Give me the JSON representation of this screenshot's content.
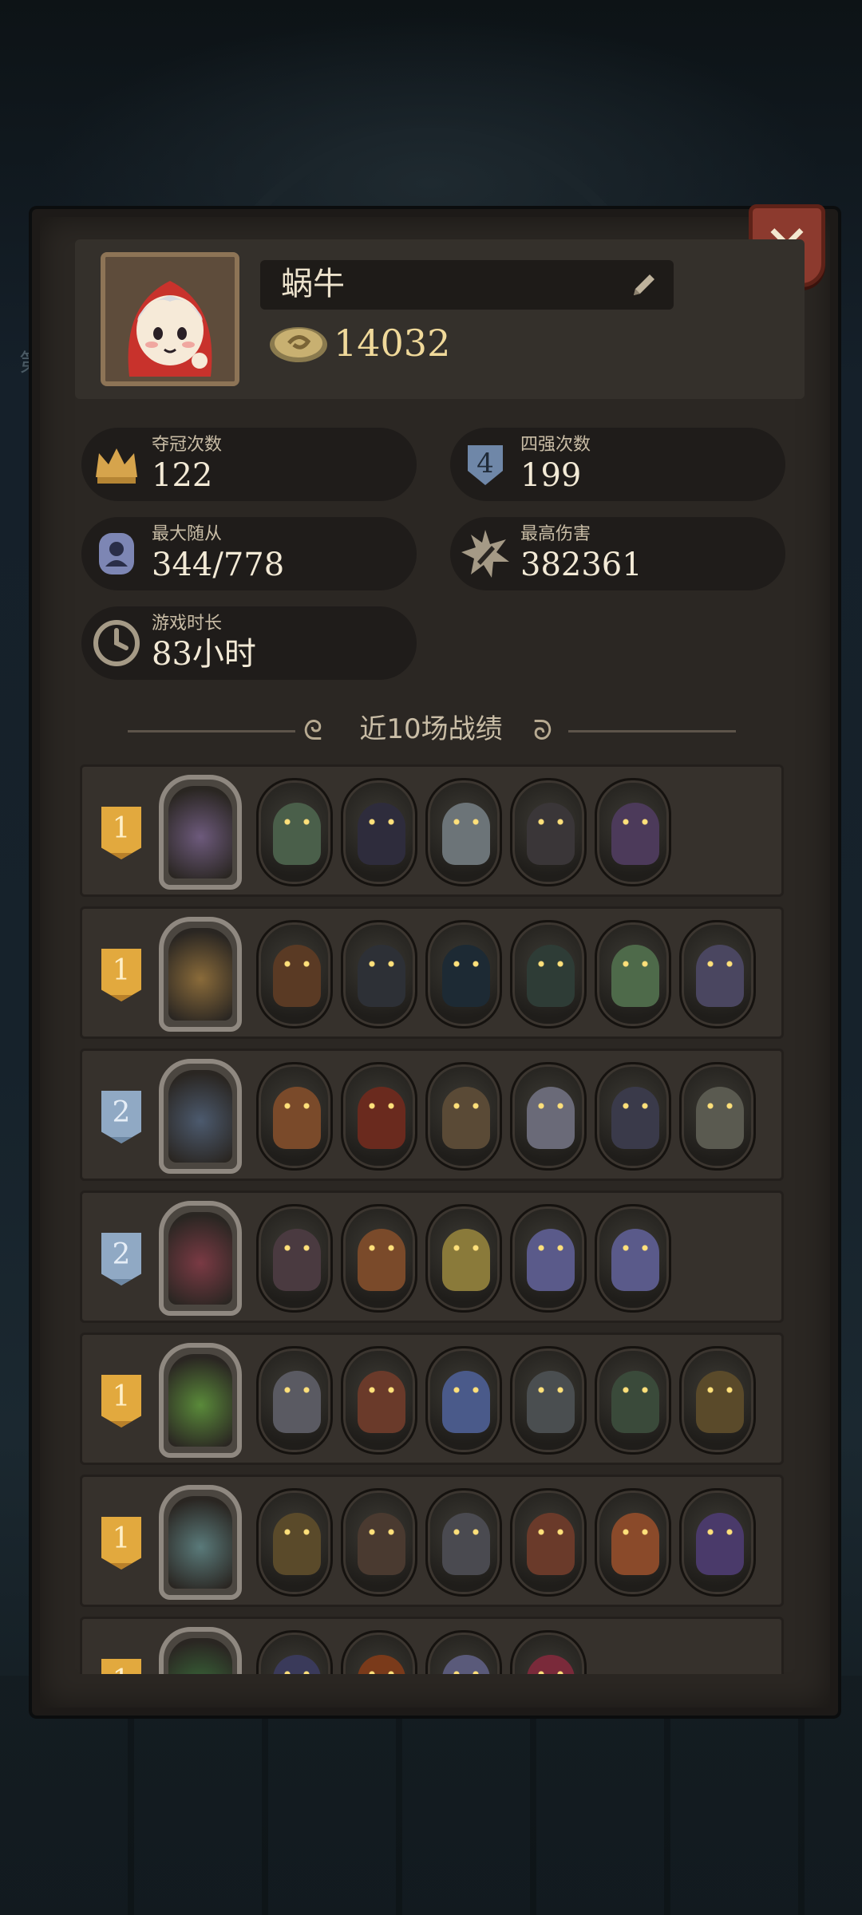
{
  "background": {
    "side_text": "第"
  },
  "profile": {
    "name": "蜗牛",
    "coins": "14032"
  },
  "stats": [
    {
      "label": "夺冠次数",
      "value": "122",
      "icon": "crown-icon"
    },
    {
      "label": "四强次数",
      "value": "199",
      "icon": "shield-four-icon"
    },
    {
      "label": "最大随从",
      "value": "344/778",
      "icon": "follower-icon"
    },
    {
      "label": "最高伤害",
      "value": "382361",
      "icon": "damage-burst-icon"
    },
    {
      "label": "游戏时长",
      "value": "83小时",
      "icon": "clock-icon"
    }
  ],
  "section": {
    "title": "近10场战绩"
  },
  "matches": [
    {
      "rank": "1",
      "tier": "gold",
      "hero": "#6d5a7c",
      "units": [
        "#4a5f4a",
        "#2e2c3c",
        "#6c7478",
        "#3a3638",
        "#4c3a5a"
      ]
    },
    {
      "rank": "1",
      "tier": "gold",
      "hero": "#8a6b3a",
      "units": [
        "#5a3a24",
        "#2d3036",
        "#1d2a34",
        "#2e3c36",
        "#4e6a4a",
        "#4a4660"
      ]
    },
    {
      "rank": "2",
      "tier": "silver",
      "hero": "#4c5a6e",
      "units": [
        "#7a4a2a",
        "#6a2a1e",
        "#5a4a36",
        "#6a6a78",
        "#3a3a4a",
        "#5a5a50"
      ]
    },
    {
      "rank": "2",
      "tier": "silver",
      "hero": "#7a3a44",
      "units": [
        "#4a3a40",
        "#7a4a2a",
        "#8a7a3a",
        "#5a5a8a",
        "#5a5a8a"
      ]
    },
    {
      "rank": "1",
      "tier": "gold",
      "hero": "#5a8a3a",
      "units": [
        "#5a5a62",
        "#6a3a2a",
        "#4a5a8a",
        "#4a4e50",
        "#3a4a3a",
        "#5a4a2a"
      ]
    },
    {
      "rank": "1",
      "tier": "gold",
      "hero": "#5a7a7a",
      "units": [
        "#5a4a2a",
        "#4a3a30",
        "#4a4a50",
        "#6a3a2a",
        "#8a4a2a",
        "#4a3a6a"
      ]
    },
    {
      "rank": "1",
      "tier": "gold",
      "hero": "#3a6a3a",
      "units": [
        "#3a3a5a",
        "#7a3a1a",
        "#5a5a7a",
        "#7a2a3a"
      ]
    }
  ]
}
